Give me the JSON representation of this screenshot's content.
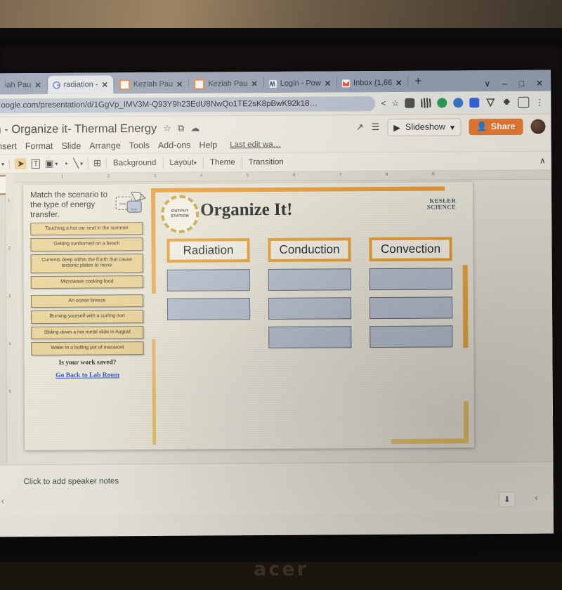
{
  "browser": {
    "tabs": [
      {
        "label": "iah Pau",
        "favicon": "blank-favicon",
        "active": false
      },
      {
        "label": "radiation -",
        "favicon": "google-icon",
        "active": true
      },
      {
        "label": "Keziah Pau",
        "favicon": "slides-icon",
        "active": false
      },
      {
        "label": "Keziah Pau",
        "favicon": "slides-icon",
        "active": false
      },
      {
        "label": "Login - Pow",
        "favicon": "powerschool-icon",
        "active": false
      },
      {
        "label": "Inbox (1,66",
        "favicon": "gmail-icon",
        "active": false
      }
    ],
    "new_tab_label": "+",
    "tab_search_label": "∨",
    "window_minimize": "–",
    "window_maximize": "□",
    "window_close": "✕",
    "url": "oogle.com/presentation/d/1GgVp_IMV3M-Q93Y9h23EdU8NwQo1TE2sK8pBwK92k18…",
    "share_icon": "share-icon",
    "bookmark_icon": "star-icon",
    "menu_icon": "kebab-menu-icon",
    "extensions": [
      "camera-extension-icon",
      "qr-extension-icon",
      "green-circle-extension-icon",
      "blue-circle-extension-icon",
      "blue-square-extension-icon",
      "shield-extension-icon",
      "puzzle-extension-icon",
      "square-extension-icon"
    ]
  },
  "docs": {
    "title": "n - Organize it- Thermal Energy",
    "star_icon": "☆",
    "move_icon": "⧉",
    "cloud_icon": "☁",
    "menu_items": [
      "Insert",
      "Format",
      "Slide",
      "Arrange",
      "Tools",
      "Add-ons",
      "Help"
    ],
    "last_edit": "Last edit wa…",
    "activity_icon": "↗",
    "comment_icon": "☰",
    "slideshow_label": "Slideshow",
    "slideshow_caret": "▾",
    "share_label": "Share",
    "share_color": "#e8762a",
    "avatar": "user-avatar"
  },
  "toolbar": {
    "zoom_icon": "⌕",
    "zoom_caret": "▾",
    "cursor_icon": "➤",
    "textbox_icon": "T",
    "image_icon": "▣",
    "image_caret": "▾",
    "shape_icon": "◔",
    "line_icon": "╲",
    "line_caret": "▾",
    "comment_icon": "⊞",
    "background_label": "Background",
    "layout_label": "Layout",
    "layout_caret": "▾",
    "theme_label": "Theme",
    "transition_label": "Transition",
    "collapse_icon": "∧"
  },
  "rulers": {
    "horizontal": [
      "1",
      "2",
      "3",
      "4",
      "5",
      "6",
      "7",
      "8",
      "9"
    ],
    "vertical": [
      "1",
      "2",
      "3",
      "4",
      "5"
    ]
  },
  "slide": {
    "prompt": "Match the scenario to the type of energy transfer.",
    "drag_icon": "drag-and-drop-icon",
    "badge_line1": "OUTPUT",
    "badge_line2": "STATION",
    "title": "Organize It!",
    "logo_line1": "KESLER",
    "logo_line2": "SCIENCE",
    "scenario_cards": [
      "Touching a hot car seat in the summer",
      "Getting sunburned on a beach",
      "Currents deep within the Earth that cause tectonic plates to move",
      "Microwave cooking food",
      "An ocean breeze",
      "Burning yourself with a curling iron",
      "Sliding down a hot metal slide in August",
      "Water in a boiling pot of macaroni"
    ],
    "saved_question": "Is your work saved?",
    "lab_room_link": "Go Back to Lab Room",
    "columns": [
      {
        "header": "Radiation",
        "dropzones": 2
      },
      {
        "header": "Conduction",
        "dropzones": 3
      },
      {
        "header": "Convection",
        "dropzones": 3
      }
    ],
    "accent_color": "#f0a12e",
    "card_color": "#f0d89a",
    "dropzone_color": "#b9c4d6"
  },
  "notes": {
    "placeholder": "Click to add speaker notes",
    "prev_icon": "‹",
    "next_icon": "‹",
    "explore_icon": "⬇"
  },
  "device": {
    "brand": "acer"
  }
}
